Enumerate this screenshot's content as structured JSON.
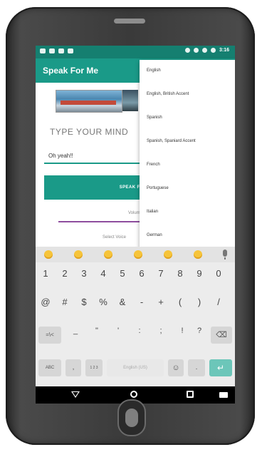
{
  "app": {
    "title": "Speak For Me"
  },
  "status_bar": {
    "time": "3:16"
  },
  "main": {
    "heading": "TYPE YOUR MIND",
    "input_value": "Oh yeah!!",
    "speak_button": "SPEAK FOR ME",
    "volume_label": "Volume",
    "select_label": "Select Voice"
  },
  "dropdown": {
    "items": [
      "English",
      "English, British Accent",
      "Spanish",
      "Spanish, Spaniard Accent",
      "French",
      "Portuguese",
      "Italian",
      "German"
    ]
  },
  "keyboard": {
    "number_row": [
      "1",
      "2",
      "3",
      "4",
      "5",
      "6",
      "7",
      "8",
      "9",
      "0"
    ],
    "symbol_row": [
      "@",
      "#",
      "$",
      "%",
      "&",
      "-",
      "+",
      "(",
      ")",
      "/"
    ],
    "third_row": [
      "=\\<",
      "_",
      "\"",
      "'",
      ":",
      ";",
      "!",
      "?"
    ],
    "bottom": {
      "abc": "ABC",
      "comma": ",",
      "fraction": "1 2 3",
      "space": "English (US)",
      "emoji": "☺",
      "period": "."
    },
    "colors": {
      "accent": "#1a9a88",
      "enter": "#6cc6b9"
    }
  }
}
